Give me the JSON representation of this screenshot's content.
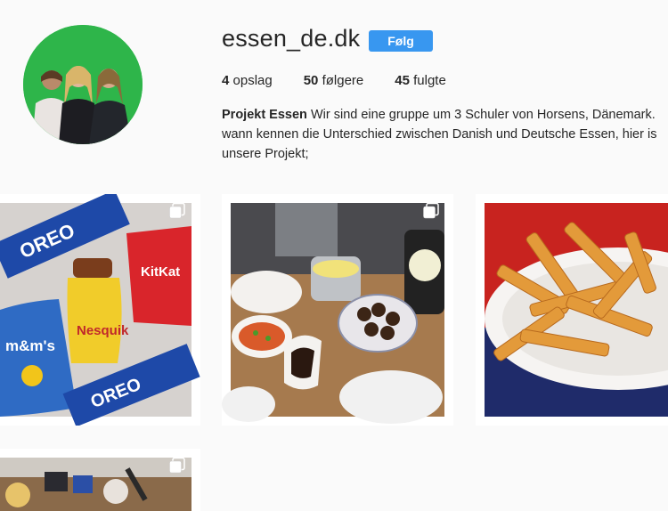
{
  "profile": {
    "username": "essen_de.dk",
    "follow_label": "Følg",
    "stats": {
      "posts_count": "4",
      "posts_label": "opslag",
      "followers_count": "50",
      "followers_label": "følgere",
      "following_count": "45",
      "following_label": "fulgte"
    },
    "bio_name": "Projekt Essen",
    "bio_text": "Wir sind eine gruppe um 3 Schuler von Horsens, Dänemark. wann kennen die Unterschied zwischen Danish und Deutsche Essen, hier is unsere Projekt;"
  },
  "posts": [
    {
      "label": "Oreo, Nesquik, M&M's and KitKat snacks",
      "icon": "multiple-images-icon"
    },
    {
      "label": "Dinner table with meatballs and potatoes",
      "icon": "multiple-images-icon"
    },
    {
      "label": "Plate of fries"
    },
    {
      "label": "Table with food",
      "icon": "multiple-images-icon"
    }
  ],
  "colors": {
    "accent": "#3897f0",
    "background": "#fafafa",
    "text": "#262626"
  }
}
